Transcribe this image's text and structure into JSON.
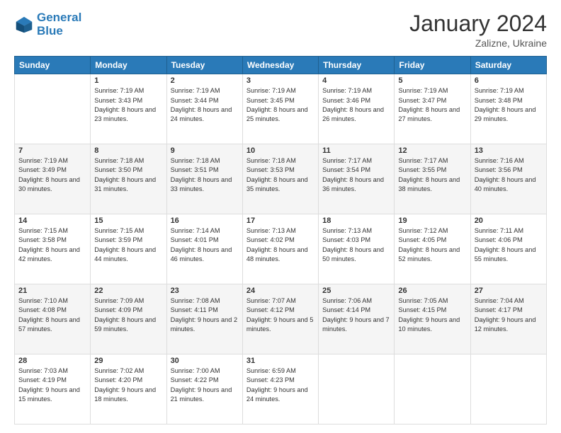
{
  "logo": {
    "line1": "General",
    "line2": "Blue"
  },
  "header": {
    "title": "January 2024",
    "subtitle": "Zalizne, Ukraine"
  },
  "weekdays": [
    "Sunday",
    "Monday",
    "Tuesday",
    "Wednesday",
    "Thursday",
    "Friday",
    "Saturday"
  ],
  "weeks": [
    [
      {
        "day": "",
        "sunrise": "",
        "sunset": "",
        "daylight": ""
      },
      {
        "day": "1",
        "sunrise": "Sunrise: 7:19 AM",
        "sunset": "Sunset: 3:43 PM",
        "daylight": "Daylight: 8 hours and 23 minutes."
      },
      {
        "day": "2",
        "sunrise": "Sunrise: 7:19 AM",
        "sunset": "Sunset: 3:44 PM",
        "daylight": "Daylight: 8 hours and 24 minutes."
      },
      {
        "day": "3",
        "sunrise": "Sunrise: 7:19 AM",
        "sunset": "Sunset: 3:45 PM",
        "daylight": "Daylight: 8 hours and 25 minutes."
      },
      {
        "day": "4",
        "sunrise": "Sunrise: 7:19 AM",
        "sunset": "Sunset: 3:46 PM",
        "daylight": "Daylight: 8 hours and 26 minutes."
      },
      {
        "day": "5",
        "sunrise": "Sunrise: 7:19 AM",
        "sunset": "Sunset: 3:47 PM",
        "daylight": "Daylight: 8 hours and 27 minutes."
      },
      {
        "day": "6",
        "sunrise": "Sunrise: 7:19 AM",
        "sunset": "Sunset: 3:48 PM",
        "daylight": "Daylight: 8 hours and 29 minutes."
      }
    ],
    [
      {
        "day": "7",
        "sunrise": "Sunrise: 7:19 AM",
        "sunset": "Sunset: 3:49 PM",
        "daylight": "Daylight: 8 hours and 30 minutes."
      },
      {
        "day": "8",
        "sunrise": "Sunrise: 7:18 AM",
        "sunset": "Sunset: 3:50 PM",
        "daylight": "Daylight: 8 hours and 31 minutes."
      },
      {
        "day": "9",
        "sunrise": "Sunrise: 7:18 AM",
        "sunset": "Sunset: 3:51 PM",
        "daylight": "Daylight: 8 hours and 33 minutes."
      },
      {
        "day": "10",
        "sunrise": "Sunrise: 7:18 AM",
        "sunset": "Sunset: 3:53 PM",
        "daylight": "Daylight: 8 hours and 35 minutes."
      },
      {
        "day": "11",
        "sunrise": "Sunrise: 7:17 AM",
        "sunset": "Sunset: 3:54 PM",
        "daylight": "Daylight: 8 hours and 36 minutes."
      },
      {
        "day": "12",
        "sunrise": "Sunrise: 7:17 AM",
        "sunset": "Sunset: 3:55 PM",
        "daylight": "Daylight: 8 hours and 38 minutes."
      },
      {
        "day": "13",
        "sunrise": "Sunrise: 7:16 AM",
        "sunset": "Sunset: 3:56 PM",
        "daylight": "Daylight: 8 hours and 40 minutes."
      }
    ],
    [
      {
        "day": "14",
        "sunrise": "Sunrise: 7:15 AM",
        "sunset": "Sunset: 3:58 PM",
        "daylight": "Daylight: 8 hours and 42 minutes."
      },
      {
        "day": "15",
        "sunrise": "Sunrise: 7:15 AM",
        "sunset": "Sunset: 3:59 PM",
        "daylight": "Daylight: 8 hours and 44 minutes."
      },
      {
        "day": "16",
        "sunrise": "Sunrise: 7:14 AM",
        "sunset": "Sunset: 4:01 PM",
        "daylight": "Daylight: 8 hours and 46 minutes."
      },
      {
        "day": "17",
        "sunrise": "Sunrise: 7:13 AM",
        "sunset": "Sunset: 4:02 PM",
        "daylight": "Daylight: 8 hours and 48 minutes."
      },
      {
        "day": "18",
        "sunrise": "Sunrise: 7:13 AM",
        "sunset": "Sunset: 4:03 PM",
        "daylight": "Daylight: 8 hours and 50 minutes."
      },
      {
        "day": "19",
        "sunrise": "Sunrise: 7:12 AM",
        "sunset": "Sunset: 4:05 PM",
        "daylight": "Daylight: 8 hours and 52 minutes."
      },
      {
        "day": "20",
        "sunrise": "Sunrise: 7:11 AM",
        "sunset": "Sunset: 4:06 PM",
        "daylight": "Daylight: 8 hours and 55 minutes."
      }
    ],
    [
      {
        "day": "21",
        "sunrise": "Sunrise: 7:10 AM",
        "sunset": "Sunset: 4:08 PM",
        "daylight": "Daylight: 8 hours and 57 minutes."
      },
      {
        "day": "22",
        "sunrise": "Sunrise: 7:09 AM",
        "sunset": "Sunset: 4:09 PM",
        "daylight": "Daylight: 8 hours and 59 minutes."
      },
      {
        "day": "23",
        "sunrise": "Sunrise: 7:08 AM",
        "sunset": "Sunset: 4:11 PM",
        "daylight": "Daylight: 9 hours and 2 minutes."
      },
      {
        "day": "24",
        "sunrise": "Sunrise: 7:07 AM",
        "sunset": "Sunset: 4:12 PM",
        "daylight": "Daylight: 9 hours and 5 minutes."
      },
      {
        "day": "25",
        "sunrise": "Sunrise: 7:06 AM",
        "sunset": "Sunset: 4:14 PM",
        "daylight": "Daylight: 9 hours and 7 minutes."
      },
      {
        "day": "26",
        "sunrise": "Sunrise: 7:05 AM",
        "sunset": "Sunset: 4:15 PM",
        "daylight": "Daylight: 9 hours and 10 minutes."
      },
      {
        "day": "27",
        "sunrise": "Sunrise: 7:04 AM",
        "sunset": "Sunset: 4:17 PM",
        "daylight": "Daylight: 9 hours and 12 minutes."
      }
    ],
    [
      {
        "day": "28",
        "sunrise": "Sunrise: 7:03 AM",
        "sunset": "Sunset: 4:19 PM",
        "daylight": "Daylight: 9 hours and 15 minutes."
      },
      {
        "day": "29",
        "sunrise": "Sunrise: 7:02 AM",
        "sunset": "Sunset: 4:20 PM",
        "daylight": "Daylight: 9 hours and 18 minutes."
      },
      {
        "day": "30",
        "sunrise": "Sunrise: 7:00 AM",
        "sunset": "Sunset: 4:22 PM",
        "daylight": "Daylight: 9 hours and 21 minutes."
      },
      {
        "day": "31",
        "sunrise": "Sunrise: 6:59 AM",
        "sunset": "Sunset: 4:23 PM",
        "daylight": "Daylight: 9 hours and 24 minutes."
      },
      {
        "day": "",
        "sunrise": "",
        "sunset": "",
        "daylight": ""
      },
      {
        "day": "",
        "sunrise": "",
        "sunset": "",
        "daylight": ""
      },
      {
        "day": "",
        "sunrise": "",
        "sunset": "",
        "daylight": ""
      }
    ]
  ]
}
